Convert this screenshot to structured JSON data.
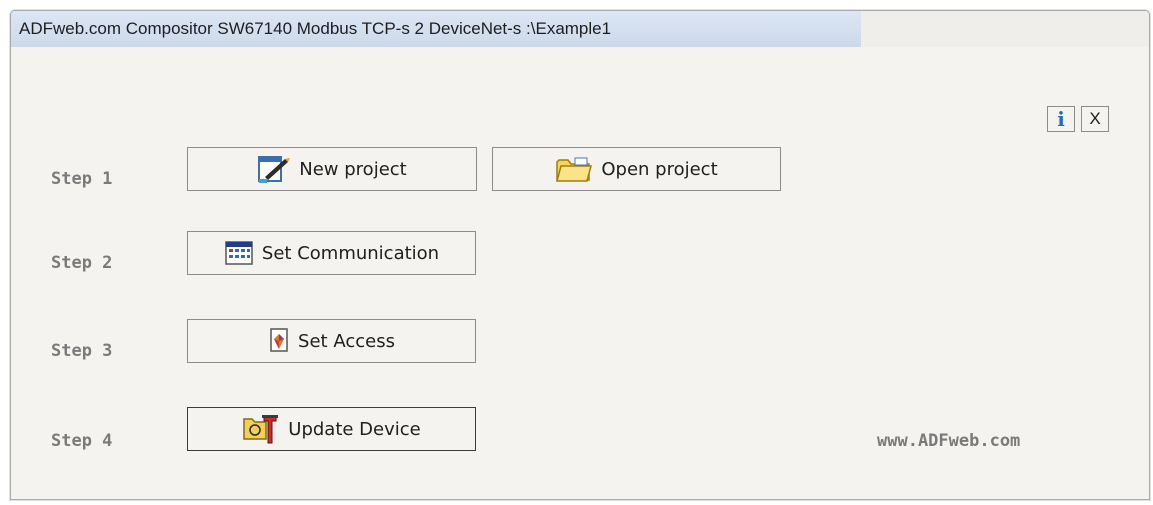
{
  "window": {
    "title": "ADFweb.com Compositor SW67140 Modbus TCP-s 2 DeviceNet-s :\\Example1"
  },
  "steps": [
    {
      "label": "Step 1"
    },
    {
      "label": "Step 2"
    },
    {
      "label": "Step 3"
    },
    {
      "label": "Step 4"
    }
  ],
  "buttons": {
    "new_project": {
      "label": "New project",
      "icon": "new-project-icon"
    },
    "open_project": {
      "label": "Open project",
      "icon": "folder-icon"
    },
    "set_communication": {
      "label": "Set Communication",
      "icon": "communication-table-icon"
    },
    "set_access": {
      "label": "Set Access",
      "icon": "access-icon"
    },
    "update_device": {
      "label": "Update Device",
      "icon": "update-device-icon"
    }
  },
  "toolbar": {
    "info_icon": "info-icon",
    "info_label": "i",
    "close_icon": "close-icon",
    "close_label": "X"
  },
  "footer": {
    "website": "www.ADFweb.com"
  },
  "colors": {
    "info_blue": "#1f6fc7",
    "step_label_gray": "#7a7a7a",
    "background": "#f4f3ef"
  }
}
